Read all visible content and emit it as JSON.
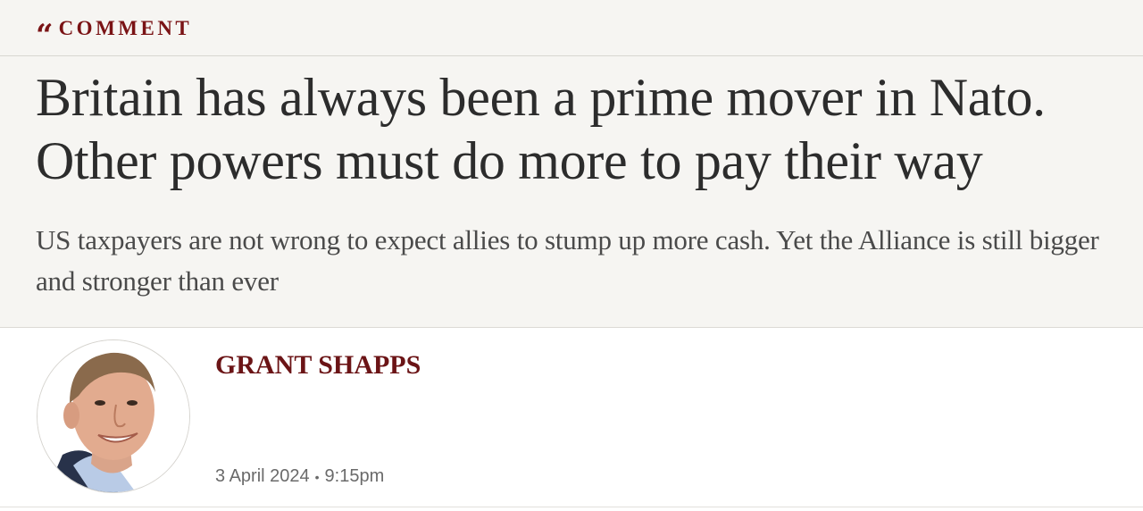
{
  "section": {
    "icon": "double-quote-icon",
    "label": "COMMENT",
    "color": "#7a1315"
  },
  "article": {
    "headline": "Britain has always been a prime mover in Nato. Other powers must do more to pay their way",
    "standfirst": "US taxpayers are not wrong to expect allies to stump up more cash. Yet the Alliance is still bigger and stronger than ever"
  },
  "byline": {
    "author": "GRANT SHAPPS",
    "author_color": "#6b1416",
    "date": "3 April 2024",
    "separator": "•",
    "time": "9:15pm"
  }
}
